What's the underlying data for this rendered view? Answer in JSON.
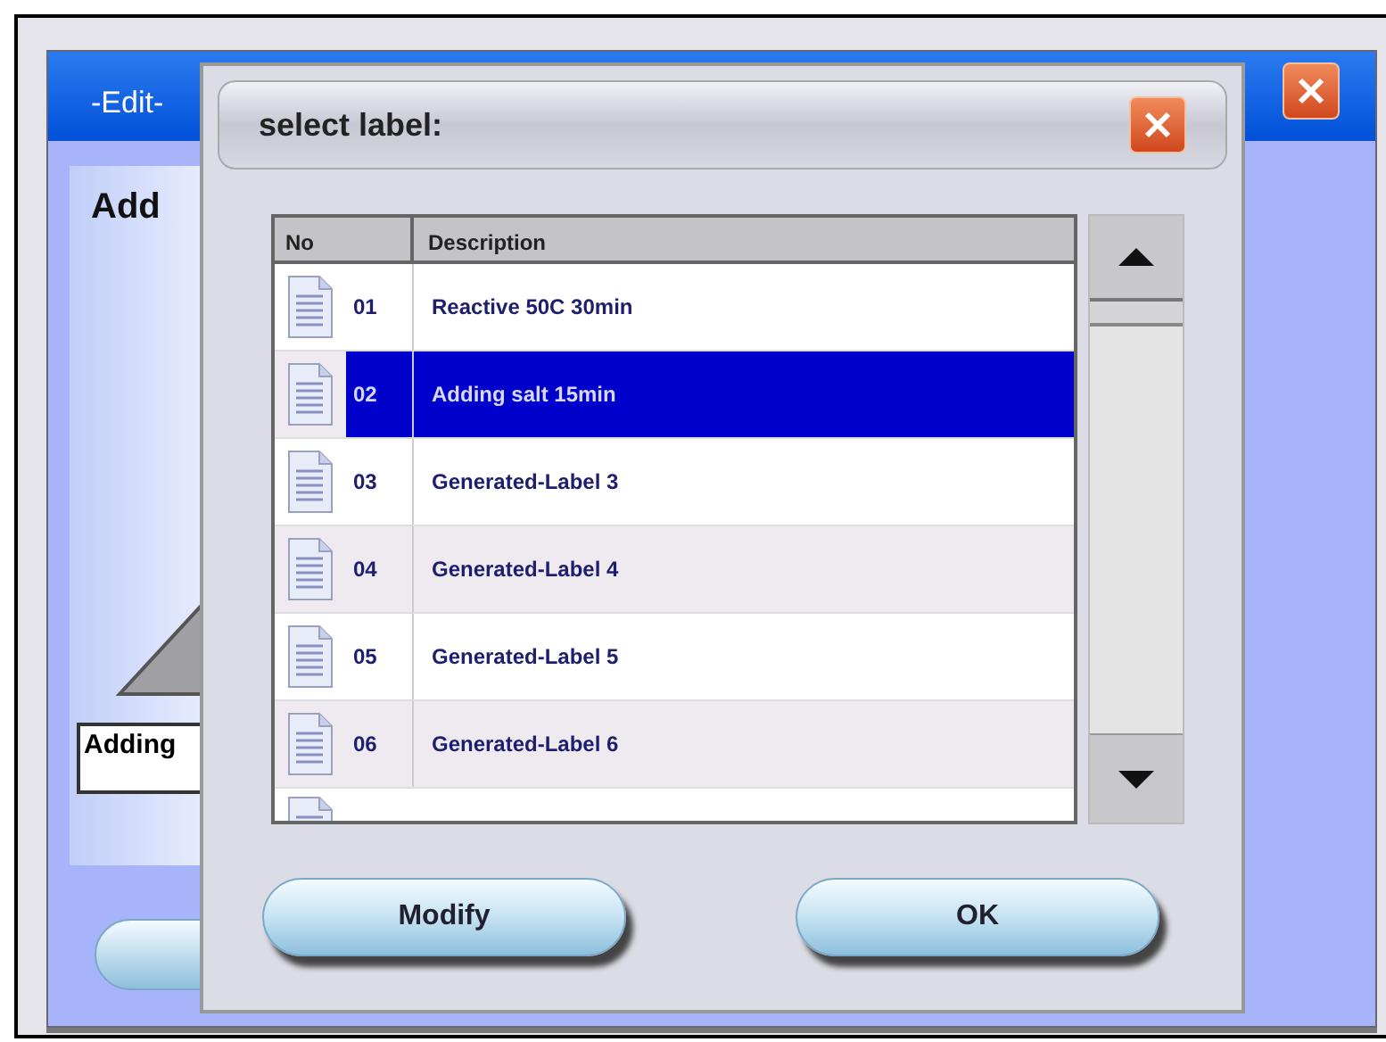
{
  "back_window": {
    "title": "-Edit-",
    "heading": "Add",
    "field_value": "Adding"
  },
  "dialog": {
    "title": "select label:",
    "table": {
      "columns": [
        "No",
        "Description"
      ],
      "rows": [
        {
          "no": "01",
          "description": "Reactive 50C 30min",
          "selected": false
        },
        {
          "no": "02",
          "description": "Adding salt 15min",
          "selected": true
        },
        {
          "no": "03",
          "description": "Generated-Label 3",
          "selected": false
        },
        {
          "no": "04",
          "description": "Generated-Label 4",
          "selected": false
        },
        {
          "no": "05",
          "description": "Generated-Label 5",
          "selected": false
        },
        {
          "no": "06",
          "description": "Generated-Label 6",
          "selected": false
        }
      ]
    },
    "buttons": [
      "Modify",
      "OK"
    ]
  }
}
